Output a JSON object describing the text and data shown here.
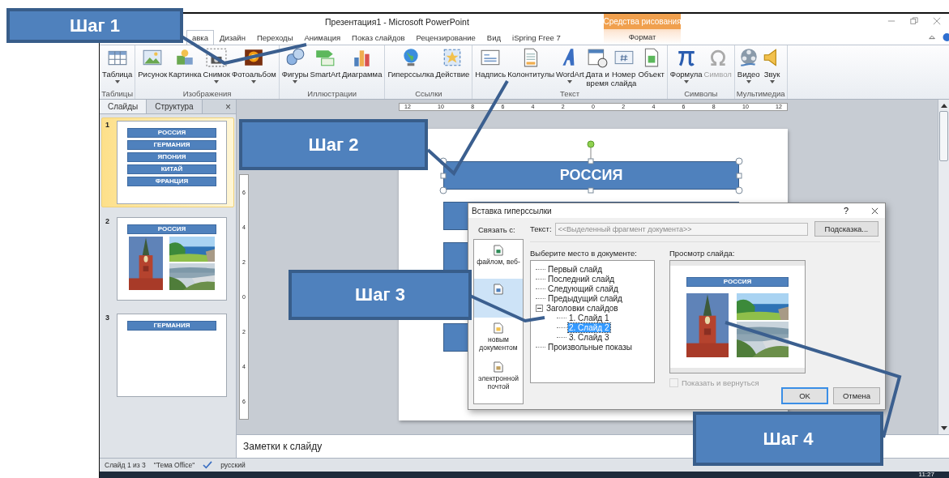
{
  "window": {
    "title": "Презентация1 - Microsoft PowerPoint"
  },
  "tabs": [
    {
      "label": "авка",
      "selected": true
    },
    {
      "label": "Дизайн",
      "selected": false
    },
    {
      "label": "Переходы",
      "selected": false
    },
    {
      "label": "Анимация",
      "selected": false
    },
    {
      "label": "Показ слайдов",
      "selected": false
    },
    {
      "label": "Рецензирование",
      "selected": false
    },
    {
      "label": "Вид",
      "selected": false
    },
    {
      "label": "iSpring Free 7",
      "selected": false
    }
  ],
  "contextual": {
    "group": "Средства рисования",
    "tab": {
      "label": "Формат",
      "selected": false
    }
  },
  "ribbon": {
    "groups": [
      {
        "label": "Таблицы",
        "buttons": [
          {
            "lines": [
              "Таблица"
            ],
            "dropdown": true,
            "disabled": false
          }
        ]
      },
      {
        "label": "Изображения",
        "buttons": [
          {
            "lines": [
              "Рисунок"
            ],
            "dropdown": false,
            "disabled": false
          },
          {
            "lines": [
              "Картинка"
            ],
            "dropdown": false,
            "disabled": false
          },
          {
            "lines": [
              "Снимок"
            ],
            "dropdown": true,
            "disabled": false
          },
          {
            "lines": [
              "Фотоальбом"
            ],
            "dropdown": true,
            "disabled": false
          }
        ]
      },
      {
        "label": "Иллюстрации",
        "buttons": [
          {
            "lines": [
              "Фигуры"
            ],
            "dropdown": true,
            "disabled": false
          },
          {
            "lines": [
              "SmartArt"
            ],
            "dropdown": false,
            "disabled": false
          },
          {
            "lines": [
              "Диаграмма"
            ],
            "dropdown": false,
            "disabled": false
          }
        ]
      },
      {
        "label": "Ссылки",
        "buttons": [
          {
            "lines": [
              "Гиперссылка"
            ],
            "dropdown": false,
            "disabled": false
          },
          {
            "lines": [
              "Действие"
            ],
            "dropdown": false,
            "disabled": false
          }
        ]
      },
      {
        "label": "Текст",
        "buttons": [
          {
            "lines": [
              "Надпись"
            ],
            "dropdown": false,
            "disabled": false
          },
          {
            "lines": [
              "Колонтитулы"
            ],
            "dropdown": false,
            "disabled": false
          },
          {
            "lines": [
              "WordArt"
            ],
            "dropdown": true,
            "disabled": false
          },
          {
            "lines": [
              "Дата и",
              "время"
            ],
            "dropdown": false,
            "disabled": false
          },
          {
            "lines": [
              "Номер",
              "слайда"
            ],
            "dropdown": false,
            "disabled": false
          },
          {
            "lines": [
              "Объект"
            ],
            "dropdown": false,
            "disabled": false
          }
        ]
      },
      {
        "label": "Символы",
        "buttons": [
          {
            "lines": [
              "Формула"
            ],
            "dropdown": true,
            "disabled": false
          },
          {
            "lines": [
              "Символ"
            ],
            "dropdown": false,
            "disabled": true
          }
        ]
      },
      {
        "label": "Мультимедиа",
        "buttons": [
          {
            "lines": [
              "Видео"
            ],
            "dropdown": true,
            "disabled": false
          },
          {
            "lines": [
              "Звук"
            ],
            "dropdown": true,
            "disabled": false
          }
        ]
      }
    ]
  },
  "slides_panel": {
    "tabs": [
      {
        "label": "Слайды",
        "selected": true
      },
      {
        "label": "Структура",
        "selected": false
      }
    ],
    "close": "×",
    "slides": [
      {
        "number": "1",
        "selected": true,
        "titles": [
          "РОССИЯ",
          "ГЕРМАНИЯ",
          "ЯПОНИЯ",
          "КИТАЙ",
          "ФРАНЦИЯ"
        ]
      },
      {
        "number": "2",
        "selected": false,
        "titles": [
          "РОССИЯ"
        ],
        "pictures": [
          {
            "kind": "picture"
          },
          {
            "kind": "picture"
          },
          {
            "kind": "picture"
          }
        ]
      },
      {
        "number": "3",
        "selected": false,
        "titles": [
          "ГЕРМАНИЯ"
        ]
      }
    ]
  },
  "rulers": {
    "horizontal": [
      "12",
      "10",
      "8",
      "6",
      "4",
      "2",
      "0",
      "2",
      "4",
      "6",
      "8",
      "10",
      "12"
    ],
    "vertical": [
      "6",
      "4",
      "2",
      "0",
      "2",
      "4",
      "6"
    ]
  },
  "slide": {
    "title": {
      "text": "РОССИЯ",
      "selected": true
    }
  },
  "notes": {
    "placeholder": "Заметки к слайду"
  },
  "status_bar": {
    "slide": "Слайд 1 из 3",
    "theme": "\"Тема Office\"",
    "language": "русский"
  },
  "taskbar": {
    "clock": "11:27"
  },
  "dialog": {
    "title": "Вставка гиперссылки",
    "help": "?",
    "link_label": "Связать с:",
    "link_targets": [
      {
        "lines": [
          "файлом, веб-"
        ],
        "selected": false
      },
      {
        "selected": true
      },
      {
        "lines": [
          "новым",
          "документом"
        ],
        "selected": false
      },
      {
        "lines": [
          "электронной",
          "почтой"
        ],
        "selected": false
      }
    ],
    "text_label": "Текст:",
    "text_field": {
      "value": "<<Выделенный фрагмент документа>>",
      "disabled": true
    },
    "screentip_button": "Подсказка...",
    "place_label": "Выберите место в документе:",
    "places": [
      {
        "label": "Первый слайд",
        "selected": false
      },
      {
        "label": "Последний слайд",
        "selected": false
      },
      {
        "label": "Следующий слайд",
        "selected": false
      },
      {
        "label": "Предыдущий слайд",
        "selected": false
      },
      {
        "label": "Заголовки слайдов",
        "selected": false,
        "expanded": true,
        "children": [
          {
            "label": "1. Слайд 1",
            "selected": false
          },
          {
            "label": "2. Слайд 2",
            "selected": true
          },
          {
            "label": "3. Слайд 3",
            "selected": false
          }
        ]
      },
      {
        "label": "Произвольные показы",
        "selected": false
      }
    ],
    "preview_label": "Просмотр слайда:",
    "preview": {
      "title": "РОССИЯ",
      "pictures": [
        {
          "kind": "picture"
        },
        {
          "kind": "picture"
        },
        {
          "kind": "picture"
        }
      ]
    },
    "show_and_return": {
      "label": "Показать и вернуться",
      "checked": false,
      "disabled": true
    },
    "buttons": [
      "OK",
      "Отмена"
    ]
  },
  "callouts": [
    {
      "label": "Шаг 1"
    },
    {
      "label": "Шаг 2"
    },
    {
      "label": "Шаг 3"
    },
    {
      "label": "Шаг 4"
    }
  ]
}
